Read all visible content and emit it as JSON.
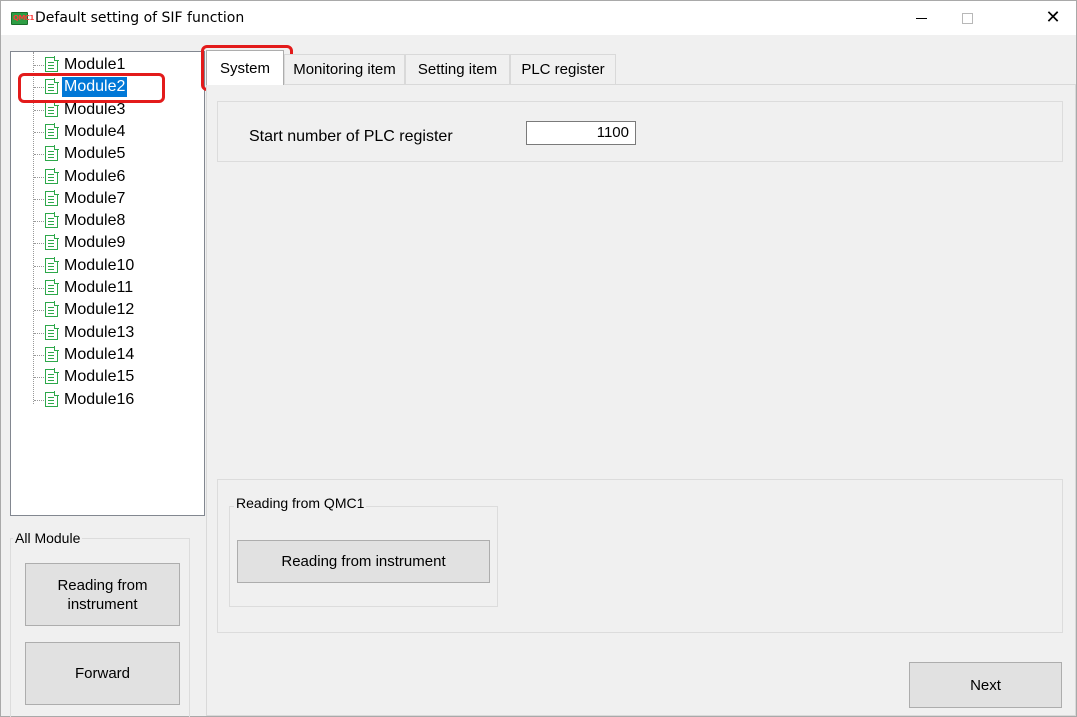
{
  "window": {
    "title": "Default setting of SIF function",
    "app_icon_text": "QMC1"
  },
  "tree": {
    "items": [
      {
        "label": "Module1"
      },
      {
        "label": "Module2"
      },
      {
        "label": "Module3"
      },
      {
        "label": "Module4"
      },
      {
        "label": "Module5"
      },
      {
        "label": "Module6"
      },
      {
        "label": "Module7"
      },
      {
        "label": "Module8"
      },
      {
        "label": "Module9"
      },
      {
        "label": "Module10"
      },
      {
        "label": "Module11"
      },
      {
        "label": "Module12"
      },
      {
        "label": "Module13"
      },
      {
        "label": "Module14"
      },
      {
        "label": "Module15"
      },
      {
        "label": "Module16"
      }
    ],
    "selected": "Module2"
  },
  "all_module": {
    "legend": "All Module",
    "reading_button": "Reading from instrument",
    "forward_button": "Forward"
  },
  "tabs": [
    {
      "label": "System",
      "active": true
    },
    {
      "label": "Monitoring item",
      "active": false
    },
    {
      "label": "Setting item",
      "active": false
    },
    {
      "label": "PLC register",
      "active": false
    }
  ],
  "system": {
    "start_register_label": "Start number of PLC register",
    "start_register_value": "1100",
    "reading_group_legend": "Reading from QMC1",
    "reading_button": "Reading from instrument"
  },
  "footer": {
    "next_button": "Next"
  },
  "colors": {
    "selection": "#0078d7",
    "highlight_box": "#e31b1b",
    "doc_icon": "#2da84a"
  }
}
